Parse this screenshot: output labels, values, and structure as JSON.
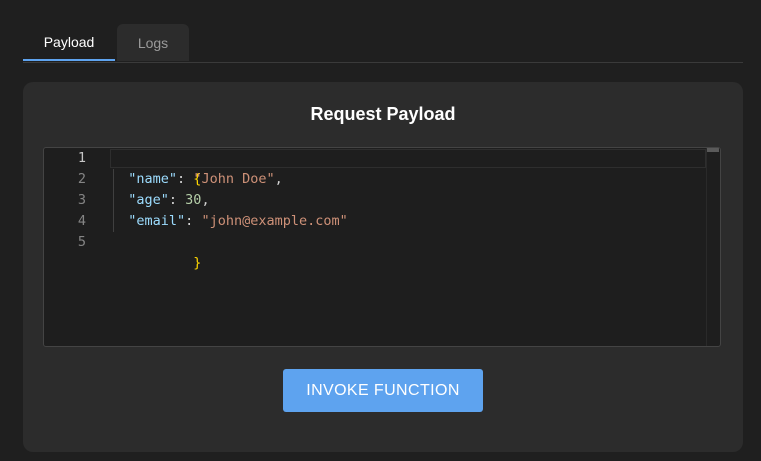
{
  "tabs": [
    {
      "label": "Payload",
      "active": true
    },
    {
      "label": "Logs",
      "active": false
    }
  ],
  "panel": {
    "title": "Request Payload"
  },
  "editor": {
    "line_numbers": [
      "1",
      "2",
      "3",
      "4",
      "5"
    ],
    "lines": [
      {
        "open": "{"
      },
      {
        "key": "\"name\"",
        "sep": ": ",
        "value": "\"John Doe\"",
        "end": ","
      },
      {
        "key": "\"age\"",
        "sep": ": ",
        "value": "30",
        "end": ","
      },
      {
        "key": "\"email\"",
        "sep": ": ",
        "value": "\"john@example.com\"",
        "end": ""
      },
      {
        "close": "}"
      }
    ]
  },
  "invoke_button": {
    "label": "INVOKE FUNCTION"
  },
  "colors": {
    "accent": "#5ea3ef",
    "background": "#1f1f1f",
    "panel": "#2c2c2c",
    "editor_bg": "#1e1e1e",
    "json_key": "#9cdcfe",
    "json_string": "#ce9178",
    "json_number": "#b5cea8",
    "json_brace": "#ffd700"
  }
}
